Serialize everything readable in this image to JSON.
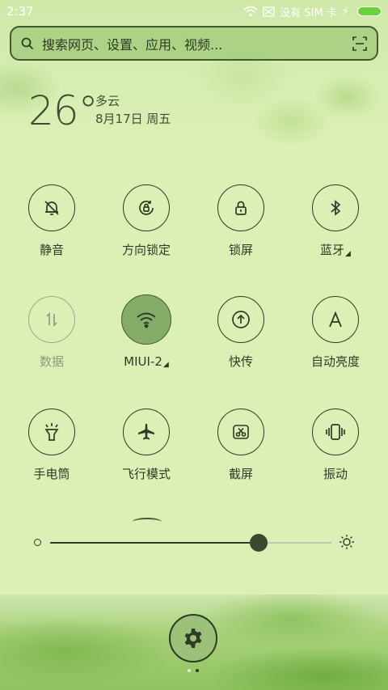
{
  "status": {
    "time": "2:37",
    "carrier": "没有 SIM 卡"
  },
  "search": {
    "placeholder": "搜索网页、设置、应用、视频..."
  },
  "weather": {
    "temperature": "26°",
    "condition": "多云",
    "date": "8月17日 周五"
  },
  "toggles": [
    {
      "label": "静音",
      "icon": "bell-off-icon",
      "state": "off"
    },
    {
      "label": "方向锁定",
      "icon": "rotation-lock-icon",
      "state": "off"
    },
    {
      "label": "锁屏",
      "icon": "lock-icon",
      "state": "off"
    },
    {
      "label": "蓝牙",
      "icon": "bluetooth-icon",
      "state": "off",
      "has_menu": true
    },
    {
      "label": "数据",
      "icon": "mobile-data-icon",
      "state": "disabled"
    },
    {
      "label": "MIUI-2",
      "icon": "wifi-icon",
      "state": "on",
      "has_menu": true
    },
    {
      "label": "快传",
      "icon": "share-icon",
      "state": "off"
    },
    {
      "label": "自动亮度",
      "icon": "auto-brightness-icon",
      "state": "off"
    },
    {
      "label": "手电筒",
      "icon": "flashlight-icon",
      "state": "off"
    },
    {
      "label": "飞行模式",
      "icon": "airplane-icon",
      "state": "off"
    },
    {
      "label": "截屏",
      "icon": "screenshot-icon",
      "state": "off"
    },
    {
      "label": "振动",
      "icon": "vibrate-icon",
      "state": "off"
    }
  ],
  "brightness": {
    "level": 0.74
  },
  "pager": {
    "pages": 2,
    "current": 2
  },
  "colors": {
    "accent": "#86ad68",
    "foreground": "#2f3b26",
    "battery": "#6ad13a"
  }
}
